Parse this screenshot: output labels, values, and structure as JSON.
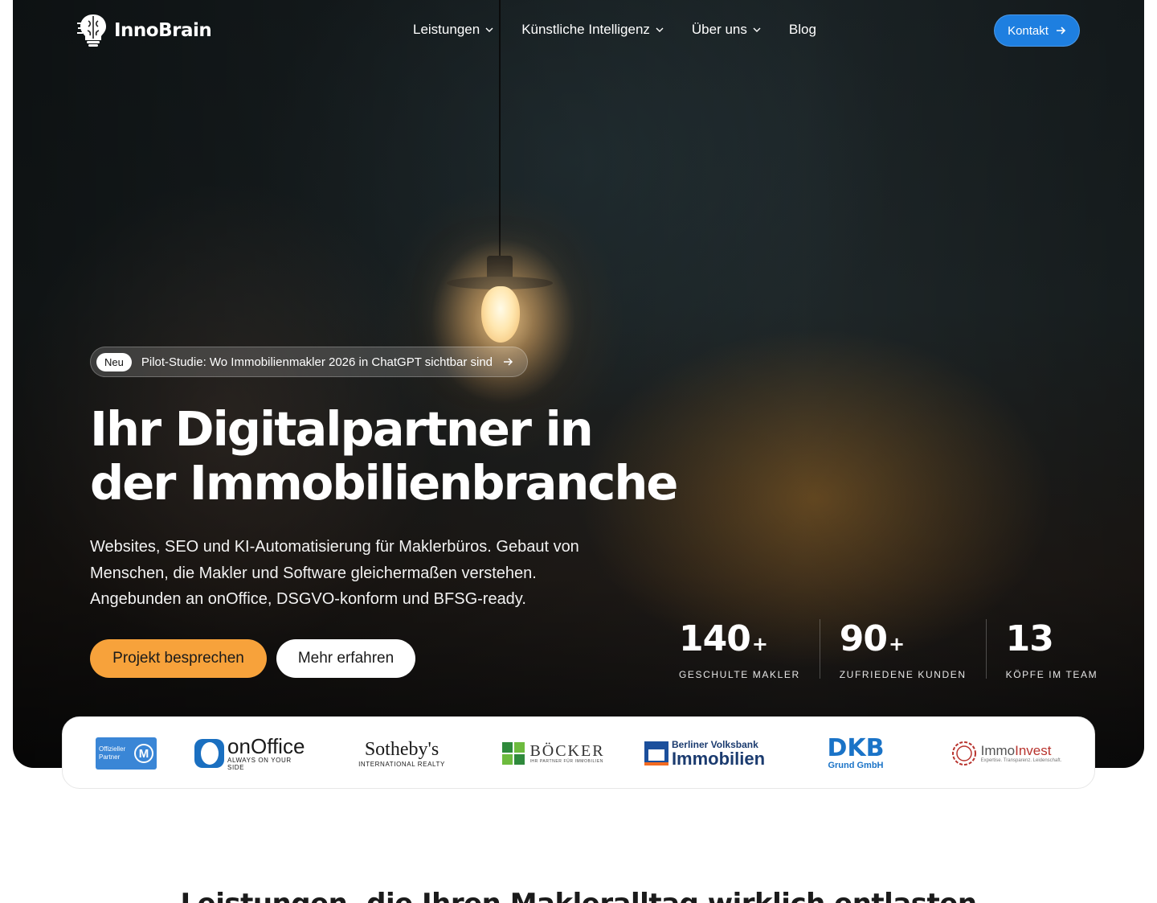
{
  "brand": {
    "name": "InnoBrain"
  },
  "nav": {
    "items": [
      {
        "label": "Leistungen",
        "has_dropdown": true
      },
      {
        "label": "Künstliche Intelligenz",
        "has_dropdown": true
      },
      {
        "label": "Über uns",
        "has_dropdown": true
      },
      {
        "label": "Blog",
        "has_dropdown": false
      }
    ],
    "cta_label": "Kontakt"
  },
  "announcement": {
    "badge": "Neu",
    "text": "Pilot-Studie: Wo Immobilienmakler 2026 in ChatGPT sichtbar sind"
  },
  "hero": {
    "title_line1": "Ihr Digitalpartner in",
    "title_line2": "der Immobilienbranche",
    "subtitle": "Websites, SEO und KI-Automatisierung für Maklerbüros. Gebaut von Menschen, die Makler und Software gleichermaßen verstehen. Angebunden an onOffice, DSGVO-konform und BFSG-ready.",
    "primary_button": "Projekt besprechen",
    "secondary_button": "Mehr erfahren"
  },
  "stats": [
    {
      "value": "140",
      "suffix": "+",
      "label": "GESCHULTE MAKLER"
    },
    {
      "value": "90",
      "suffix": "+",
      "label": "ZUFRIEDENE KUNDEN"
    },
    {
      "value": "13",
      "suffix": "",
      "label": "KÖPFE IM TEAM"
    }
  ],
  "partners": {
    "onoffice_badge": {
      "line1": "Offizieller",
      "line2": "Partner"
    },
    "onoffice": {
      "name": "onOffice",
      "tagline": "ALWAYS ON YOUR SIDE"
    },
    "sothebys": {
      "name": "Sotheby's",
      "tagline": "INTERNATIONAL REALTY"
    },
    "boecker": {
      "name": "BÖCKER",
      "tagline": "IHR PARTNER FÜR IMMOBILIEN"
    },
    "volksbank": {
      "line1": "Berliner Volksbank",
      "line2": "Immobilien"
    },
    "dkb": {
      "name": "DKB",
      "tagline": "Grund GmbH"
    },
    "immoinvest": {
      "name_a": "Immo",
      "name_b": "Invest",
      "tagline": "Expertise. Transparenz. Leidenschaft."
    }
  },
  "next_section": {
    "title": "Leistungen, die Ihren Makleralltag wirklich entlasten"
  },
  "colors": {
    "accent": "#1e7fe0",
    "primary_cta": "#f7a23b"
  }
}
